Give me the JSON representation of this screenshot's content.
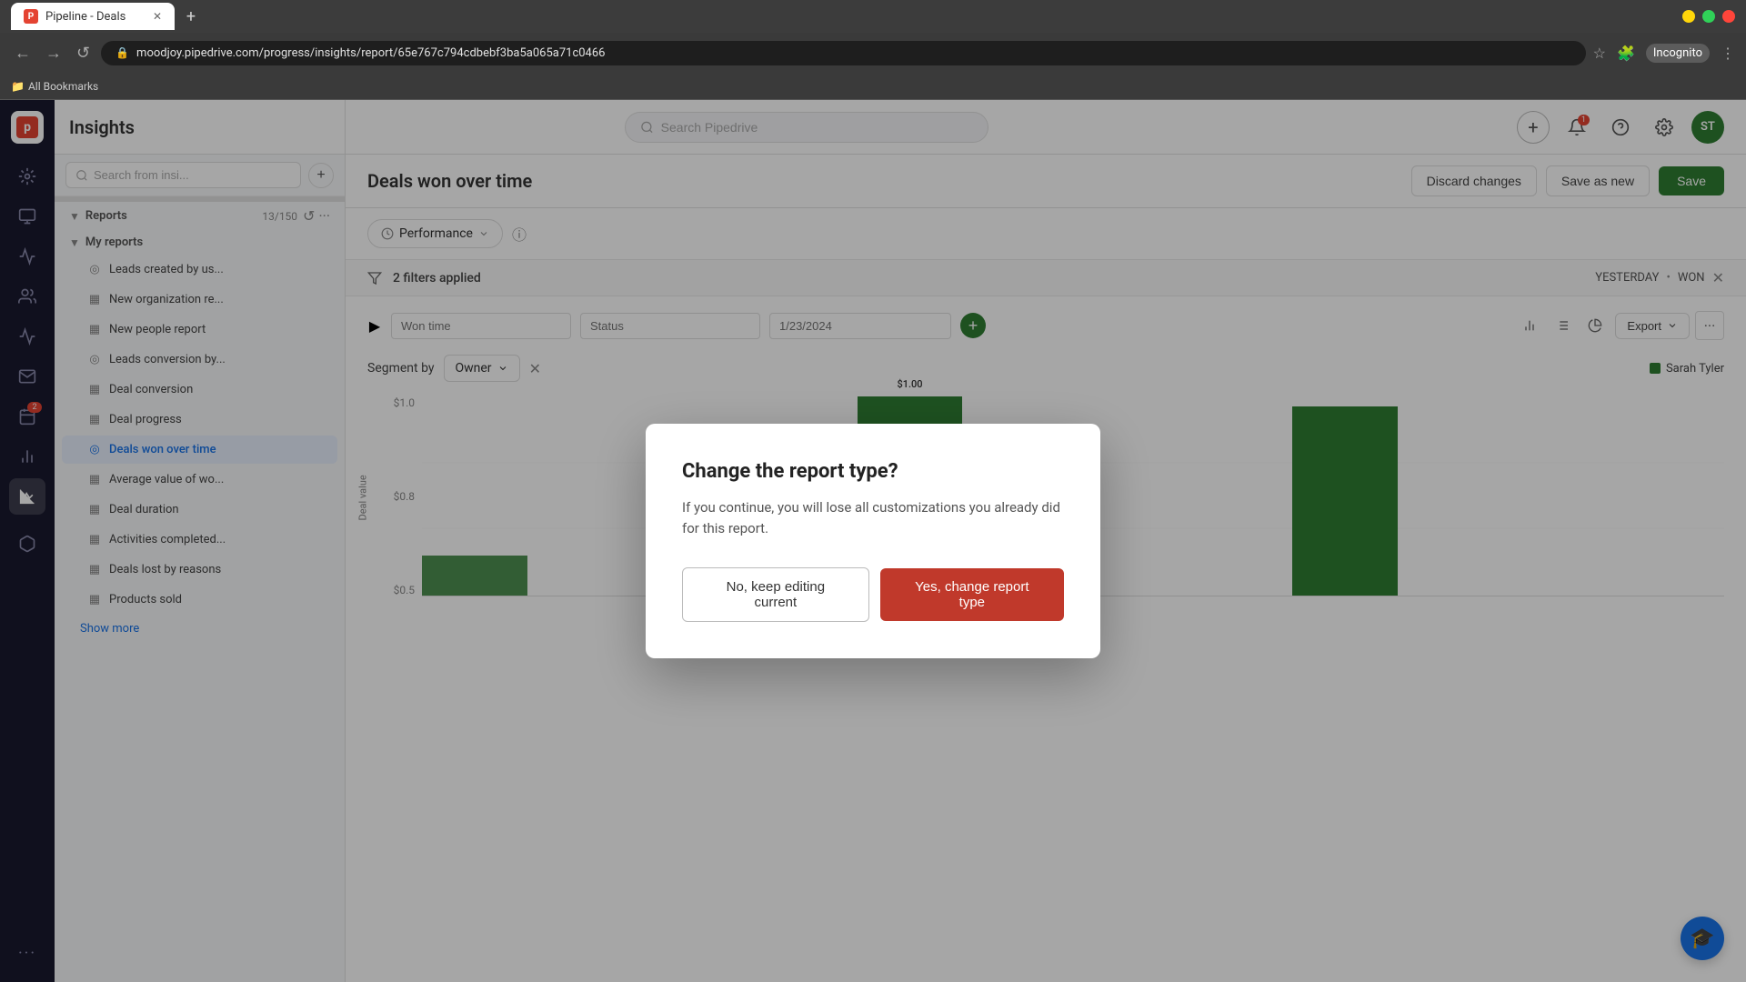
{
  "browser": {
    "tab_title": "Pipeline - Deals",
    "tab_favicon": "P",
    "url": "moodjoy.pipedrive.com/progress/insights/report/65e767c794cdbebf3ba5a065a71c0466",
    "new_tab_label": "+",
    "nav_back": "←",
    "nav_forward": "→",
    "nav_refresh": "↺",
    "bookmarks_label": "All Bookmarks",
    "profile_label": "Incognito"
  },
  "app_header": {
    "logo_text": "p",
    "title": "Insights",
    "search_placeholder": "Search Pipedrive",
    "add_btn_label": "+",
    "notification_badge": "1",
    "avatar_initials": "ST"
  },
  "sidebar": {
    "search_placeholder": "Search from insi...",
    "add_btn_label": "+",
    "reports_section": {
      "label": "Reports",
      "chevron": "▼",
      "count": "13/150",
      "settings_label": "⚙"
    },
    "my_reports": {
      "label": "My reports",
      "items": [
        {
          "id": "leads-created",
          "icon": "◎",
          "label": "Leads created by us..."
        },
        {
          "id": "new-org-report",
          "icon": "▦",
          "label": "New organization re..."
        },
        {
          "id": "new-people",
          "icon": "▦",
          "label": "New people report"
        },
        {
          "id": "leads-conversion",
          "icon": "◎",
          "label": "Leads conversion by..."
        },
        {
          "id": "deal-conversion",
          "icon": "▦",
          "label": "Deal conversion"
        },
        {
          "id": "deal-progress",
          "icon": "▦",
          "label": "Deal progress"
        },
        {
          "id": "deals-won",
          "icon": "◎",
          "label": "Deals won over time"
        },
        {
          "id": "average-value",
          "icon": "▦",
          "label": "Average value of wo..."
        },
        {
          "id": "deal-duration",
          "icon": "▦",
          "label": "Deal duration"
        },
        {
          "id": "activities-completed",
          "icon": "▦",
          "label": "Activities completed..."
        },
        {
          "id": "deals-lost",
          "icon": "▦",
          "label": "Deals lost by reasons"
        },
        {
          "id": "products-sold",
          "icon": "▦",
          "label": "Products sold"
        }
      ]
    },
    "show_more_label": "Show more"
  },
  "report": {
    "title": "Deals won over time",
    "discard_label": "Discard changes",
    "save_new_label": "Save as new",
    "save_label": "Save",
    "performance_label": "Performance",
    "filters_count": "2 filters applied",
    "filter_date": "YESTERDAY",
    "filter_status": "WON",
    "filter_won_time_label": "Won time",
    "filter_status_label": "Status",
    "date_range": "1/23/2024",
    "segment_label": "Segment by",
    "segment_value": "Owner",
    "legend_label": "Sarah Tyler",
    "legend_color": "#2e7d32",
    "export_label": "Export",
    "chart_y_labels": [
      "$1.0",
      "$0.8",
      "$0.5"
    ],
    "chart_bar_value": "$1.00",
    "view_icons": [
      "bar-chart",
      "list",
      "pie-chart"
    ]
  },
  "modal": {
    "title": "Change the report type?",
    "body": "If you continue, you will lose all customizations you already did for this report.",
    "cancel_label": "No, keep editing current",
    "confirm_label": "Yes, change report type"
  },
  "help_icon": "🎓"
}
